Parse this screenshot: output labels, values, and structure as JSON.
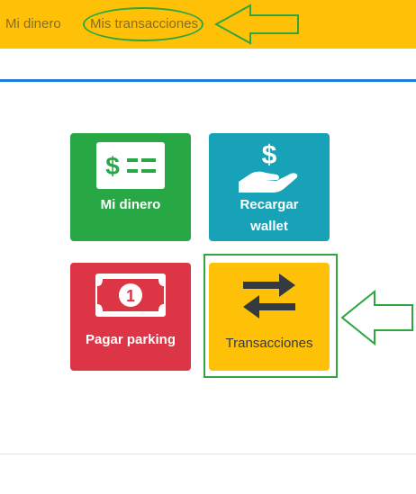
{
  "nav": {
    "mi_dinero": "Mi dinero",
    "mis_transacciones": "Mis transacciones"
  },
  "tiles": [
    {
      "label": "Mi dinero",
      "icon": "money-bill-icon",
      "color": "#28a745"
    },
    {
      "label_line1": "Recargar",
      "label_line2": "wallet",
      "icon": "hand-dollar-icon",
      "color": "#17a2b8"
    },
    {
      "label": "Pagar parking",
      "icon": "money-bill-coin-icon",
      "color": "#dc3545"
    },
    {
      "label": "Transacciones",
      "icon": "exchange-arrows-icon",
      "color": "#ffc107"
    }
  ],
  "colors": {
    "topbar": "#ffc107",
    "accent_line": "#1e7be0",
    "annotation": "#2fa640"
  }
}
